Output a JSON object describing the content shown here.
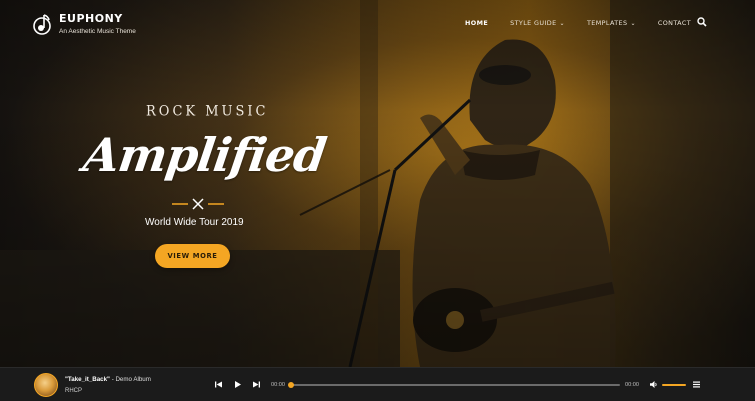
{
  "header": {
    "brand_name": "EUPHONY",
    "brand_tagline": "An Aesthetic Music Theme",
    "nav": [
      {
        "label": "HOME",
        "active": true
      },
      {
        "label": "STYLE GUIDE",
        "dropdown": true
      },
      {
        "label": "TEMPLATES",
        "dropdown": true
      },
      {
        "label": "CONTACT"
      }
    ],
    "search_icon": "search-icon"
  },
  "hero": {
    "eyebrow": "ROCK MUSIC",
    "headline": "Amplified",
    "subtitle": "World Wide Tour 2019",
    "cta_label": "VIEW MORE"
  },
  "player": {
    "track_title": "\"Take_it_Back\"",
    "album_sep": " - ",
    "album": "Demo Album",
    "artist": "RHCP",
    "current_time": "00:00",
    "total_time": "00:00",
    "progress": 0,
    "volume": 1.0
  },
  "colors": {
    "accent": "#f4a623",
    "player_bg": "#1b1b1b"
  }
}
